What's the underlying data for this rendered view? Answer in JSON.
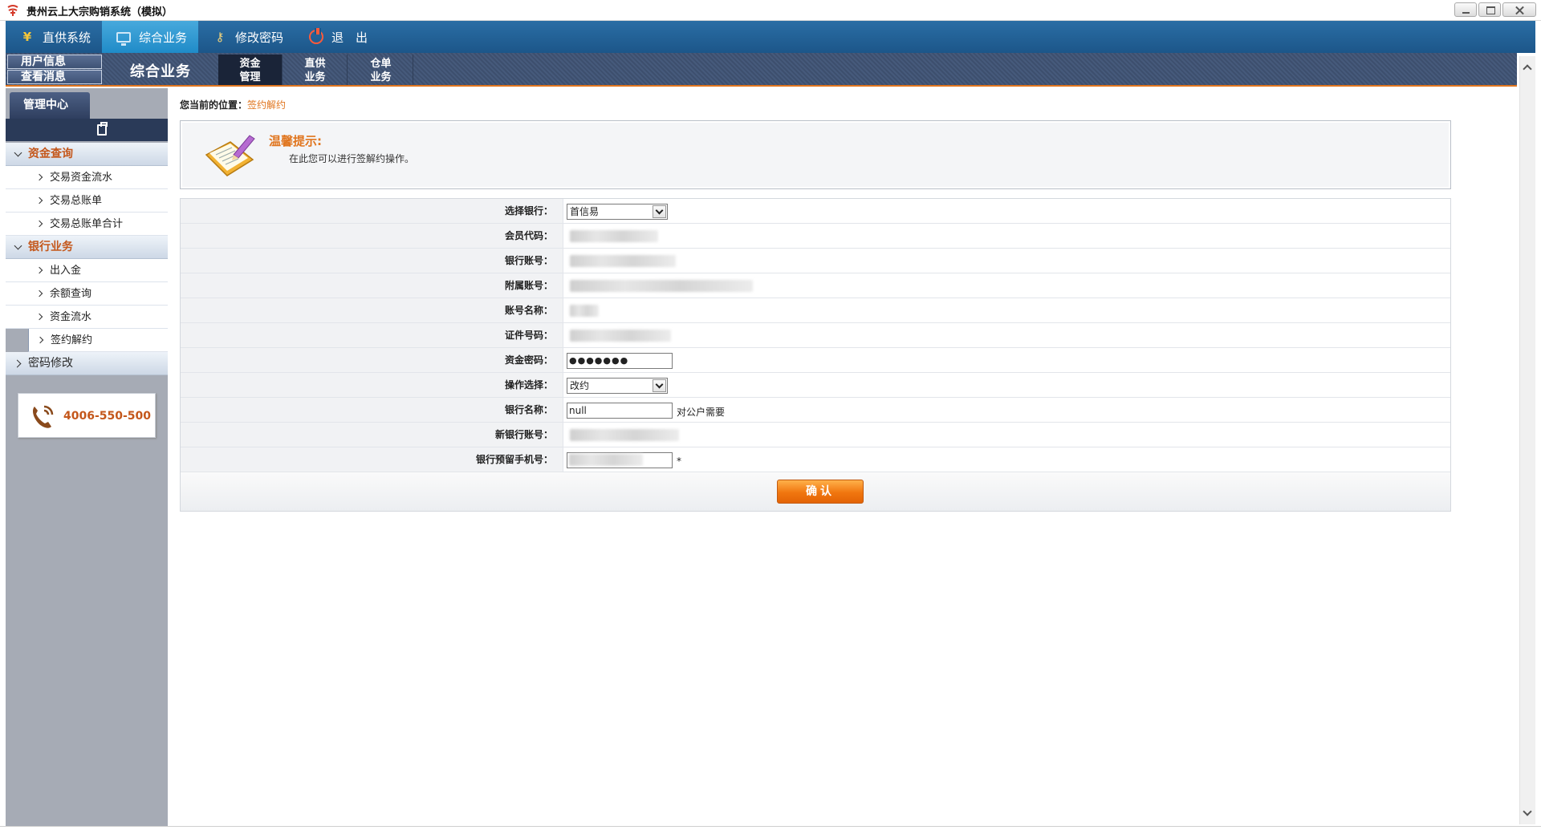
{
  "window": {
    "title": "贵州云上大宗购销系统（模拟）",
    "icon": "app-logo-icon"
  },
  "menu": {
    "items": [
      {
        "label": "直供系统",
        "icon": "yen-icon"
      },
      {
        "label": "综合业务",
        "icon": "monitor-icon"
      },
      {
        "label": "修改密码",
        "icon": "key-icon"
      },
      {
        "label": "退　出",
        "icon": "power-icon"
      }
    ],
    "active": "综合业务",
    "active_color": "#1f8bc8"
  },
  "subbar": {
    "user_buttons": [
      "用户信息",
      "查看消息"
    ],
    "title": "综合业务",
    "tabs": [
      {
        "line1": "资金",
        "line2": "管理"
      },
      {
        "line1": "直供",
        "line2": "业务"
      },
      {
        "line1": "仓单",
        "line2": "业务"
      }
    ]
  },
  "sidebar": {
    "tab": "管理中心",
    "groups": [
      {
        "label": "资金查询",
        "expanded": true,
        "items": [
          "交易资金流水",
          "交易总账单",
          "交易总账单合计"
        ]
      },
      {
        "label": "银行业务",
        "expanded": true,
        "items": [
          "出入金",
          "余额查询",
          "资金流水",
          "签约解约"
        ],
        "selected": "签约解约"
      },
      {
        "label": "密码修改",
        "expanded": false,
        "items": []
      }
    ],
    "hotline": "4006-550-500"
  },
  "content": {
    "breadcrumb_prefix": "您当前的位置：",
    "breadcrumb_current": "签约解约",
    "tip_title": "温馨提示:",
    "tip_text": "在此您可以进行签解约操作。",
    "form": {
      "labels": {
        "bank_select": "选择银行：",
        "member_code": "会员代码：",
        "bank_account": "银行账号：",
        "sub_account": "附属账号：",
        "account_name": "账号名称：",
        "id_number": "证件号码：",
        "fund_password": "资金密码：",
        "operation": "操作选择：",
        "bank_name": "银行名称：",
        "new_bank_account": "新银行账号：",
        "reserved_phone": "银行预留手机号："
      },
      "bank_select_value": "首信易",
      "fund_password_mask": "●●●●●●●",
      "operation_value": "改约",
      "bank_name_value": "null",
      "bank_name_note": "对公户需要",
      "required_mark": "*",
      "submit_label": "确认"
    },
    "accent_color": "#e0751e"
  }
}
